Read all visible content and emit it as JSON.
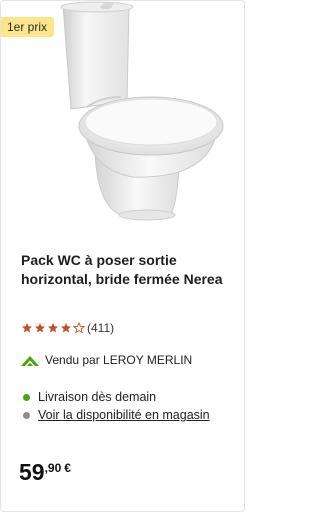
{
  "badge": "1er prix",
  "product": {
    "title": "Pack WC à poser sortie horizontal, bride fermée Nerea",
    "rating": {
      "stars": 4,
      "max": 5,
      "count": "(411)"
    },
    "seller": "Vendu par LEROY MERLIN",
    "delivery": "Livraison dès demain",
    "availability_link": "Voir la disponibilité en magasin",
    "price": {
      "units": "59",
      "cents": ",90",
      "currency": "€"
    }
  },
  "colors": {
    "badge_bg": "#fde68a",
    "star": "#c4502b",
    "delivery_dot": "#46a610",
    "availability_dot": "#8c8c8c",
    "brand_green": "#46a610"
  },
  "icons": [
    "product-image",
    "leroy-merlin-logo-icon",
    "star-icon"
  ]
}
